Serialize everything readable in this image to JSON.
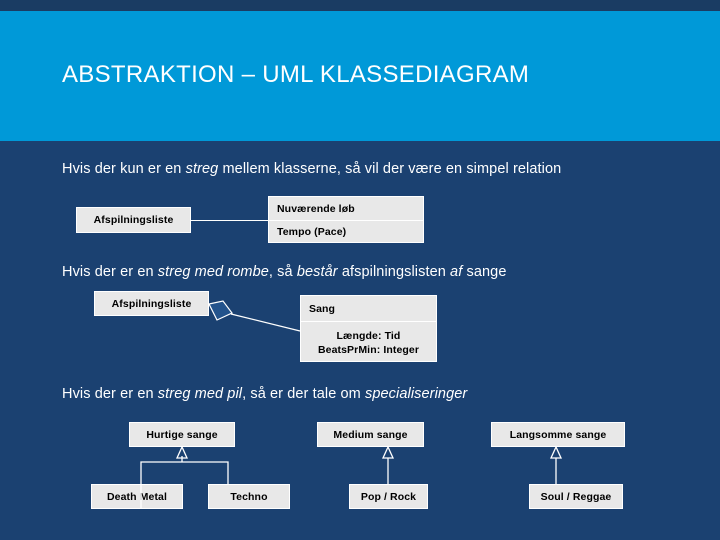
{
  "slide": {
    "title": "ABSTRAKTION – UML KLASSEDIAGRAM",
    "colors": {
      "background": "#1b4171",
      "banner": "#0099d8",
      "top_band": "#1a3c63",
      "box_fill": "#e8e8e8",
      "box_border": "#ffffff",
      "text": "#ffffff"
    }
  },
  "sections": {
    "relation": {
      "caption": {
        "part1": "Hvis der kun er en ",
        "em1": "streg",
        "part2": " mellem klasserne, så vil der være en simpel relation"
      },
      "left_box": "Afspilningsliste",
      "right_box": {
        "row1": "Nuværende løb",
        "row2": "Tempo (Pace)"
      }
    },
    "aggregation": {
      "caption": {
        "part1": "Hvis der er en ",
        "em1": "streg med rombe",
        "part2": ", så ",
        "em2": "består",
        "part3": " afspilningslisten ",
        "em3": "af",
        "part4": " sange"
      },
      "left_box": "Afspilningsliste",
      "right_box": {
        "header": "Sang",
        "attr1": "Længde: Tid",
        "attr2": "BeatsPrMin: Integer"
      }
    },
    "specialization": {
      "caption": {
        "part1": "Hvis der er en ",
        "em1": "streg med pil",
        "part2": ", så er der tale om ",
        "em2": "specialiseringer"
      },
      "groups": [
        {
          "parent": "Hurtige sange",
          "children": [
            "Death Metal",
            "Techno"
          ]
        },
        {
          "parent": "Medium sange",
          "children": [
            "Pop / Rock"
          ]
        },
        {
          "parent": "Langsomme sange",
          "children": [
            "Soul / Reggae"
          ]
        }
      ]
    }
  }
}
